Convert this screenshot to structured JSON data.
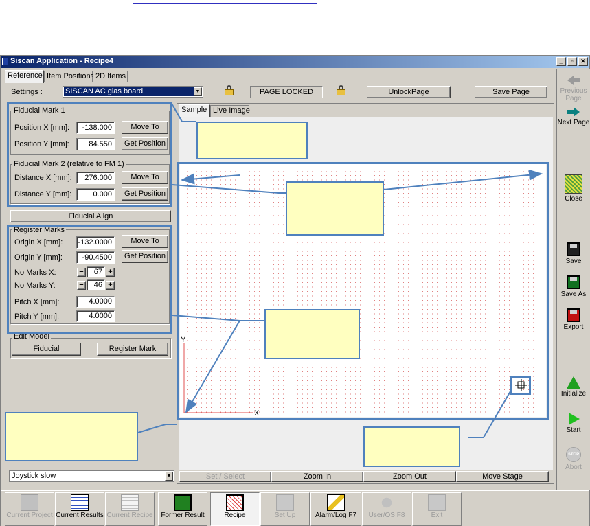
{
  "app": {
    "title": "Siscan Application - Recipe4",
    "window_buttons": [
      "_",
      "▫",
      "✕"
    ]
  },
  "tabs": [
    "Reference",
    "Item Positions",
    "2D Items"
  ],
  "settings": {
    "label": "Settings :",
    "value": "SISCAN AC glas board"
  },
  "page_locked": "PAGE LOCKED",
  "unlock_page": "UnlockPage",
  "save_page": "Save Page",
  "fiducial1": {
    "title": "Fiducial Mark 1",
    "pos_x_label": "Position X [mm]:",
    "pos_x": "-138.000",
    "pos_y_label": "Position Y [mm]:",
    "pos_y": "84.550",
    "move_to": "Move To",
    "get_position": "Get Position"
  },
  "fiducial2": {
    "title": "Fiducial Mark 2 (relative to FM 1)",
    "dist_x_label": "Distance X [mm]:",
    "dist_x": "276.000",
    "dist_y_label": "Distance Y [mm]:",
    "dist_y": "0.000",
    "move_to": "Move To",
    "get_position": "Get Position"
  },
  "fiducial_align": "Fiducial Align",
  "register": {
    "title": "Register Marks",
    "origin_x_label": "Origin X [mm]:",
    "origin_x": "-132.0000",
    "origin_y_label": "Origin Y [mm]:",
    "origin_y": "-90.4500",
    "marks_x_label": "No Marks X:",
    "marks_x": "67",
    "marks_y_label": "No Marks Y:",
    "marks_y": "46",
    "pitch_x_label": "Pitch X [mm]:",
    "pitch_x": "4.0000",
    "pitch_y_label": "Pitch Y [mm]:",
    "pitch_y": "4.0000",
    "move_to": "Move To",
    "get_position": "Get Position",
    "minus": "−",
    "plus": "+"
  },
  "edit_model": {
    "title": "Edit Model",
    "fiducial": "Fiducial",
    "register_mark": "Register Mark"
  },
  "joystick": "Joystick slow",
  "view_tabs": [
    "Sample",
    "Live Image"
  ],
  "axis": {
    "x": "X",
    "y": "Y"
  },
  "view_buttons": [
    "Set / Select",
    "Zoom In",
    "Zoom Out",
    "Move Stage"
  ],
  "sidebar": [
    {
      "label": "Previous Page",
      "icon": "arrow-left-icon",
      "disabled": true
    },
    {
      "label": "Next Page",
      "icon": "arrow-right-icon",
      "disabled": false
    },
    {
      "label": "Close",
      "icon": "close-folder-icon",
      "disabled": false
    },
    {
      "label": "Save",
      "icon": "floppy-icon",
      "disabled": false
    },
    {
      "label": "Save As",
      "icon": "floppy-green-icon",
      "disabled": false
    },
    {
      "label": "Export",
      "icon": "floppy-red-icon",
      "disabled": false
    },
    {
      "label": "Initialize",
      "icon": "triangle-icon",
      "disabled": false
    },
    {
      "label": "Start",
      "icon": "play-icon",
      "disabled": false
    },
    {
      "label": "Abort",
      "icon": "stop-icon",
      "disabled": true
    }
  ],
  "taskbar": [
    {
      "label": "Current Project",
      "disabled": true
    },
    {
      "label": "Current Results",
      "disabled": false
    },
    {
      "label": "Current Recipe",
      "disabled": true
    },
    {
      "label": "Former Result",
      "disabled": false
    },
    {
      "label": "Recipe",
      "disabled": false
    },
    {
      "label": "Set Up",
      "disabled": true
    },
    {
      "label": "Alarm/Log F7",
      "disabled": false
    },
    {
      "label": "User/OS F8",
      "disabled": true
    },
    {
      "label": "Exit",
      "disabled": true
    }
  ],
  "colors": {
    "title_start": "#0a246a",
    "annotation_blue": "#4f81bd",
    "note_fill": "#ffffc0",
    "grid_dot": "#e08080"
  }
}
